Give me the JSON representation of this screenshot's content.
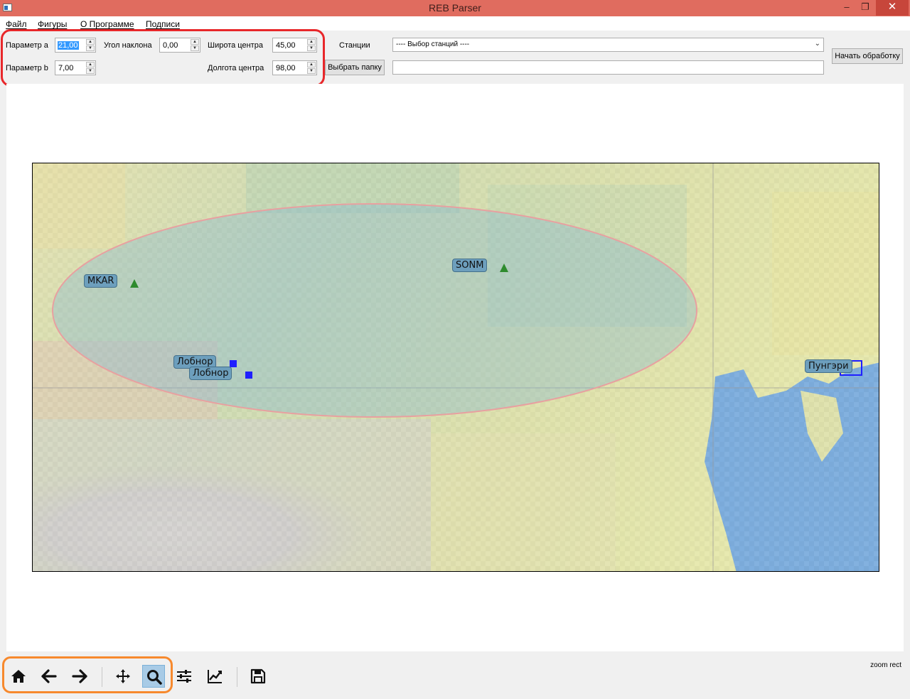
{
  "window": {
    "title": "REB Parser",
    "min_icon": "minimize-icon",
    "max_icon": "restore-icon",
    "close_icon": "close-icon"
  },
  "menu": {
    "file": "Файл",
    "shapes": "Фигуры",
    "about": "О Программе",
    "captions": "Подписи"
  },
  "params": {
    "a_label": "Параметр а",
    "a_value": "21,00",
    "b_label": "Параметр b",
    "b_value": "7,00",
    "angle_label": "Угол наклона",
    "angle_value": "0,00",
    "lat_label": "Широта центра",
    "lat_value": "45,00",
    "lon_label": "Долгота центра",
    "lon_value": "98,00"
  },
  "stations": {
    "label": "Станции",
    "selected": "---- Выбор станций ----"
  },
  "folder_button": "Выбрать папку",
  "folder_path": "",
  "start_button": "Начать обработку",
  "map": {
    "colors": {
      "ellipse_fill": "#7fb5d5",
      "ellipse_edge": "#e8a0a0",
      "station_marker": "#2e8b2e",
      "event_marker": "#1f1fff",
      "water": "#7eaede"
    },
    "labels": [
      {
        "text": "MKAR",
        "marker": "triangle"
      },
      {
        "text": "SONM",
        "marker": "triangle"
      },
      {
        "text": "Лобнор",
        "marker": "square"
      },
      {
        "text": "Лобнор",
        "marker": "square"
      },
      {
        "text": "Пунгэри",
        "marker": "square-outline"
      }
    ]
  },
  "toolbar": {
    "icons": [
      "home-icon",
      "back-arrow-icon",
      "forward-arrow-icon",
      "pan-icon",
      "zoom-icon",
      "subplots-icon",
      "line-chart-icon",
      "save-icon"
    ],
    "status": "zoom rect"
  }
}
